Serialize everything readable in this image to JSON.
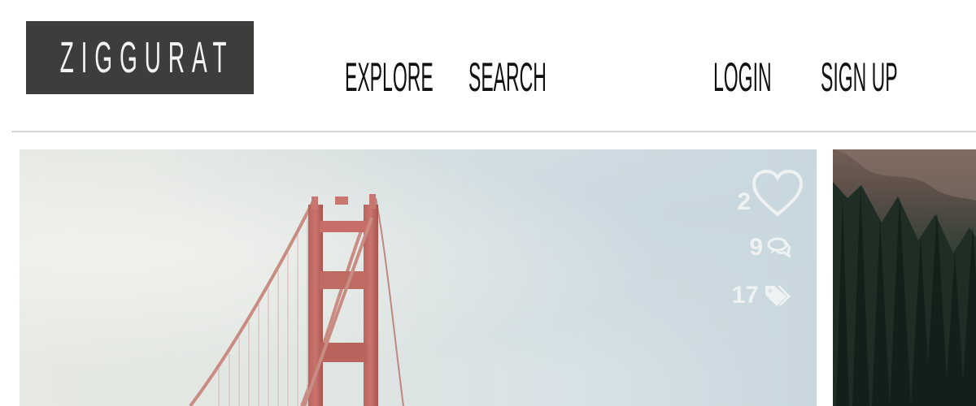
{
  "header": {
    "logo_text": "ZIGGURAT",
    "nav": {
      "explore": "EXPLORE",
      "search": "SEARCH",
      "login": "LOGIN",
      "signup": "SIGN UP"
    }
  },
  "photos": [
    {
      "stats": {
        "likes": "2",
        "comments": "9",
        "tags": "17"
      },
      "icons": [
        "heart-icon",
        "comment-icon",
        "tag-icon"
      ]
    }
  ],
  "colors": {
    "logo_background": "#3d3d3b",
    "logo_text": "#f3f3f3",
    "nav_text": "#111111",
    "divider": "#d7d7d7",
    "stat_overlay": "#f4f6f5"
  }
}
